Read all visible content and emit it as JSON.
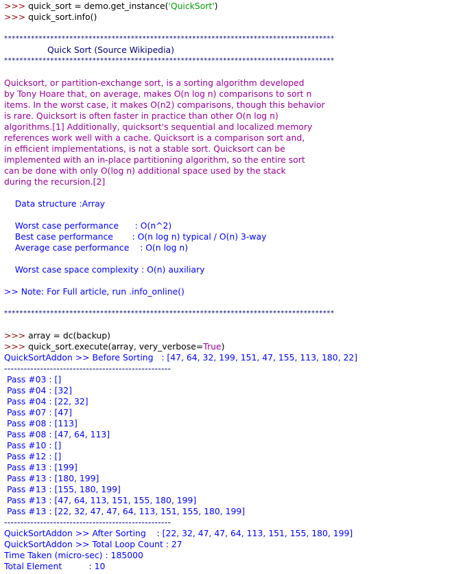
{
  "session": {
    "prompt": ">>> ",
    "cmd1_pre": "quick_sort = demo.get_instance(",
    "cmd1_str": "'QuickSort'",
    "cmd1_post": ")",
    "cmd2": "quick_sort.info()"
  },
  "info": {
    "stars": "**************************************************************************************",
    "title": "                Quick Sort (Source Wikipedia)",
    "description_lines": [
      "Quicksort, or partition-exchange sort, is a sorting algorithm developed",
      "by Tony Hoare that, on average, makes O(n log n) comparisons to sort n",
      "items. In the worst case, it makes O(n2) comparisons, though this behavior",
      "is rare. Quicksort is often faster in practice than other O(n log n)",
      "algorithms.[1] Additionally, quicksort's sequential and localized memory",
      "references work well with a cache. Quicksort is a comparison sort and,",
      "in efficient implementations, is not a stable sort. Quicksort can be",
      "implemented with an in-place partitioning algorithm, so the entire sort",
      "can be done with only O(log n) additional space used by the stack",
      "during the recursion.[2]"
    ],
    "data_structure": "    Data structure :Array",
    "worst_case": "    Worst case performance      : O(n^2)",
    "best_case": "    Best case performance       : O(n log n) typical / O(n) 3-way",
    "average_case": "    Average case performance    : O(n log n)",
    "space": "    Worst case space complexity : O(n) auxiliary",
    "note": ">> Note: For Full article, run .info_online()"
  },
  "execution": {
    "cmd3": "array = dc(backup)",
    "cmd4_pre": "quick_sort.execute(array, very_verbose=",
    "cmd4_kw": "True",
    "cmd4_post": ")",
    "before": "QuickSortAddon >> Before Sorting   : [47, 64, 32, 199, 151, 47, 155, 113, 180, 22]",
    "dashes": "---------------------------------------------------",
    "passes": [
      " Pass #03 : []",
      " Pass #04 : [32]",
      " Pass #04 : [22, 32]",
      " Pass #07 : [47]",
      " Pass #08 : [113]",
      " Pass #08 : [47, 64, 113]",
      " Pass #10 : []",
      " Pass #12 : []",
      " Pass #13 : [199]",
      " Pass #13 : [180, 199]",
      " Pass #13 : [155, 180, 199]",
      " Pass #13 : [47, 64, 113, 151, 155, 180, 199]",
      " Pass #13 : [22, 32, 47, 47, 64, 113, 151, 155, 180, 199]"
    ],
    "after": "QuickSortAddon >> After Sorting    : [22, 32, 47, 47, 64, 113, 151, 155, 180, 199]",
    "loop_count": "QuickSortAddon >> Total Loop Count : 27",
    "time_taken": "Time Taken (micro-sec) : 185000",
    "total_element": "Total Element          : 10"
  }
}
